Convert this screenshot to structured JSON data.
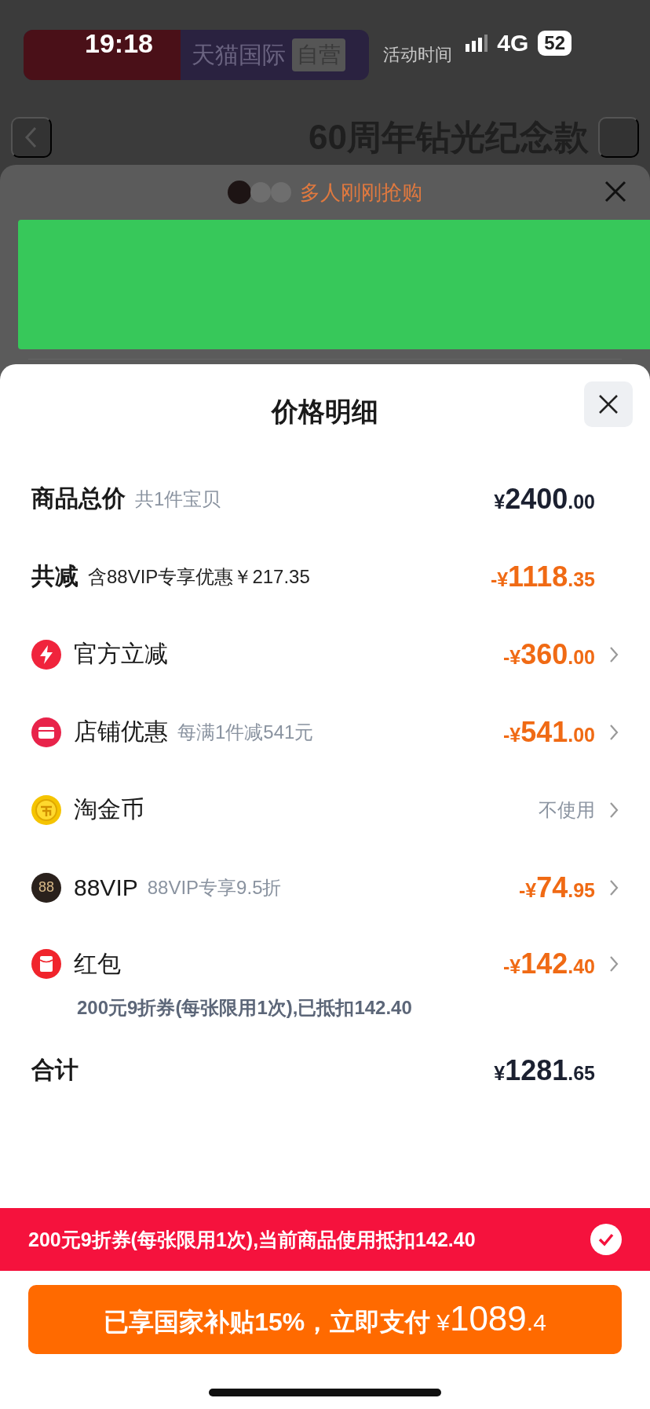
{
  "status_bar": {
    "time": "19:18",
    "network": "4G",
    "battery": "52"
  },
  "banner": {
    "brand": "天猫国际",
    "tag": "自营",
    "notice": "活动时间"
  },
  "nav": {
    "title": "60周年钻光纪念款"
  },
  "popup": {
    "headline": "多人刚刚抢购"
  },
  "sheet": {
    "title": "价格明细",
    "rows": [
      {
        "kind": "summary",
        "label": "商品总价",
        "note": "共1件宝贝",
        "amount": {
          "currency": "¥",
          "whole": "2400",
          "fraction": ".00"
        },
        "discount": false,
        "chevron": false
      },
      {
        "kind": "summary",
        "label": "共减",
        "note": "含88VIP专享优惠￥217.35",
        "amount": {
          "currency": "-¥",
          "whole": "1118",
          "fraction": ".35"
        },
        "discount": true,
        "chevron": false
      },
      {
        "kind": "item",
        "label": "官方立减",
        "amount": {
          "currency": "-¥",
          "whole": "360",
          "fraction": ".00"
        },
        "discount": true,
        "chevron": true
      },
      {
        "kind": "item",
        "label": "店铺优惠",
        "note": "每满1件减541元",
        "amount": {
          "currency": "-¥",
          "whole": "541",
          "fraction": ".00"
        },
        "discount": true,
        "chevron": true
      },
      {
        "kind": "item",
        "label": "淘金币",
        "value": "不使用",
        "chevron": true
      },
      {
        "kind": "item",
        "label": "88VIP",
        "icon_text": "88",
        "note": "88VIP专享9.5折",
        "amount": {
          "currency": "-¥",
          "whole": "74",
          "fraction": ".95"
        },
        "discount": true,
        "chevron": true
      },
      {
        "kind": "item",
        "label": "红包",
        "detail": "200元9折券(每张限用1次),已抵扣142.40",
        "amount": {
          "currency": "-¥",
          "whole": "142",
          "fraction": ".40"
        },
        "discount": true,
        "chevron": true
      },
      {
        "kind": "summary",
        "label": "合计",
        "amount": {
          "currency": "¥",
          "whole": "1281",
          "fraction": ".65"
        },
        "discount": false,
        "chevron": false
      }
    ],
    "coupon_bar": {
      "text": "200元9折券(每张限用1次),当前商品使用抵扣142.40",
      "checked": true
    },
    "pay_button": {
      "label": "已享国家补贴15%，立即支付",
      "currency": "¥",
      "whole": "1089",
      "fraction": ".4"
    }
  }
}
